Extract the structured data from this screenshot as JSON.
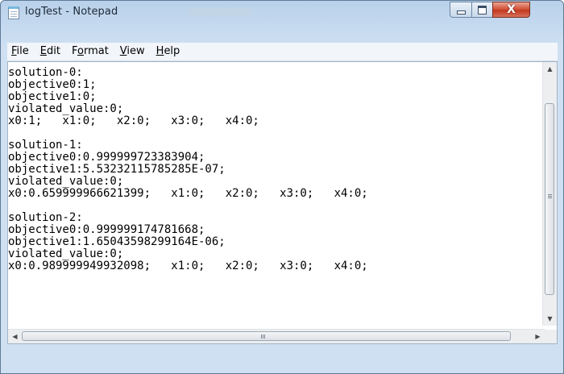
{
  "window": {
    "title": "logTest - Notepad",
    "close_symbol": "X"
  },
  "menu": {
    "items": [
      {
        "underline": "F",
        "rest": "ile"
      },
      {
        "underline": "E",
        "rest": "dit"
      },
      {
        "pre": "F",
        "underline": "o",
        "rest": "rmat"
      },
      {
        "underline": "V",
        "rest": "iew"
      },
      {
        "underline": "H",
        "rest": "elp"
      }
    ]
  },
  "document": {
    "text": "solution-0:\nobjective0:1;\nobjective1:0;\nviolated_value:0;\nx0:1;   x1:0;   x2:0;   x3:0;   x4:0;\n\nsolution-1:\nobjective0:0.999999723383904;\nobjective1:5.53232115785285E-07;\nviolated_value:0;\nx0:0.659999966621399;   x1:0;   x2:0;   x3:0;   x4:0;\n\nsolution-2:\nobjective0:0.999999174781668;\nobjective1:1.65043598299164E-06;\nviolated_value:0;\nx0:0.989999949932098;   x1:0;   x2:0;   x3:0;   x4:0;"
  },
  "icons": {
    "app": "notepad-icon",
    "minimize": "minimize-icon",
    "maximize": "maximize-icon",
    "close": "close-icon",
    "scroll_up": "arrow-up-icon",
    "scroll_down": "arrow-down-icon",
    "scroll_left": "arrow-left-icon",
    "scroll_right": "arrow-right-icon"
  },
  "colors": {
    "close_button": "#c23a1f",
    "title_bar": "#b9d1ea"
  }
}
